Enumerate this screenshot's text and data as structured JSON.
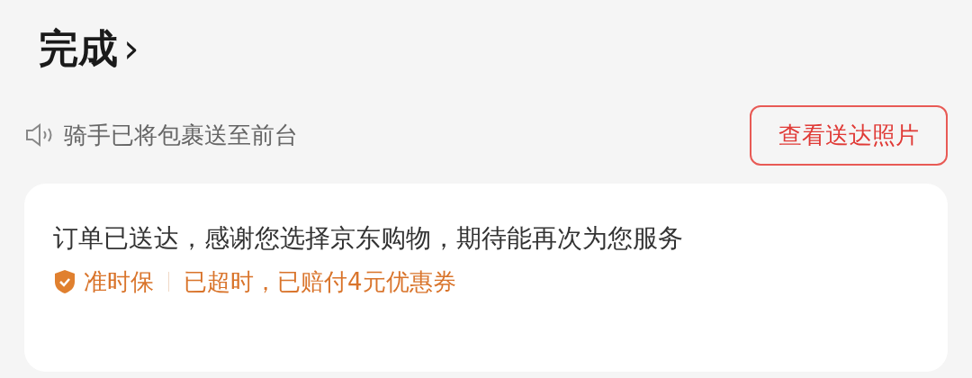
{
  "header": {
    "title": "完成",
    "chevron": "›"
  },
  "notice": {
    "text": "骑手已将包裹送至前台",
    "button": "查看送达照片"
  },
  "card": {
    "message": "订单已送达，感谢您选择京东购物，期待能再次为您服务",
    "guarantee": {
      "label": "准时保",
      "detail": "已超时，已赔付4元优惠券"
    }
  }
}
